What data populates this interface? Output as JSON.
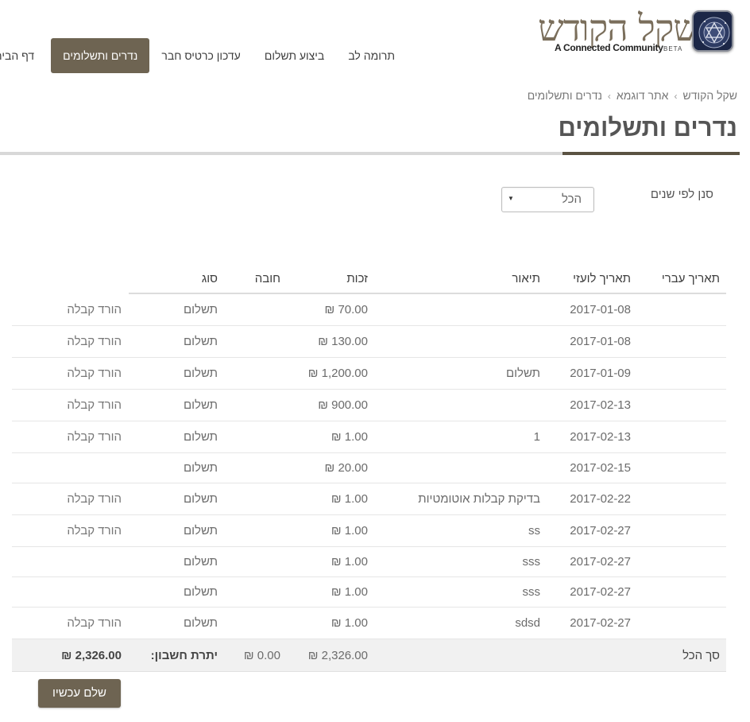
{
  "brand": {
    "name_hebrew": "שקל הקודש",
    "tagline": "A Connected Community",
    "beta": "BETA",
    "badge_color": "#1e2a4a",
    "logo_text_color": "#7a6e5b"
  },
  "nav": {
    "items": [
      {
        "label": "דף הבית",
        "active": false
      },
      {
        "label": "נדרים ותשלומים",
        "active": true
      },
      {
        "label": "עדכון כרטיס חבר",
        "active": false
      },
      {
        "label": "ביצוע תשלום",
        "active": false
      },
      {
        "label": "תרומה לב",
        "active": false
      }
    ],
    "active_color": "#6e6452"
  },
  "breadcrumb": {
    "items": [
      "שקל הקודש",
      "אתר דוגמא",
      "נדרים ותשלומים"
    ]
  },
  "page": {
    "title": "נדרים ותשלומים"
  },
  "filter": {
    "label": "סנן לפי שנים",
    "selected": "הכל"
  },
  "table": {
    "headers": {
      "hebrew_date": "תאריך עברי",
      "gregorian_date": "תאריך לועזי",
      "description": "תיאור",
      "credit": "זכות",
      "debit": "חובה",
      "type": "סוג",
      "action": ""
    },
    "rows": [
      {
        "hebrew_date": "",
        "date": "2017-01-08",
        "description": "",
        "credit": "₪ 70.00",
        "debit": "",
        "type": "תשלום",
        "action": "הורד קבלה"
      },
      {
        "hebrew_date": "",
        "date": "2017-01-08",
        "description": "",
        "credit": "₪ 130.00",
        "debit": "",
        "type": "תשלום",
        "action": "הורד קבלה"
      },
      {
        "hebrew_date": "",
        "date": "2017-01-09",
        "description": "תשלום",
        "credit": "₪ 1,200.00",
        "debit": "",
        "type": "תשלום",
        "action": "הורד קבלה"
      },
      {
        "hebrew_date": "",
        "date": "2017-02-13",
        "description": "",
        "credit": "₪ 900.00",
        "debit": "",
        "type": "תשלום",
        "action": "הורד קבלה"
      },
      {
        "hebrew_date": "",
        "date": "2017-02-13",
        "description": "1",
        "credit": "₪ 1.00",
        "debit": "",
        "type": "תשלום",
        "action": "הורד קבלה"
      },
      {
        "hebrew_date": "",
        "date": "2017-02-15",
        "description": "",
        "credit": "₪ 20.00",
        "debit": "",
        "type": "תשלום",
        "action": ""
      },
      {
        "hebrew_date": "",
        "date": "2017-02-22",
        "description": "בדיקת קבלות אוטומטיות",
        "credit": "₪ 1.00",
        "debit": "",
        "type": "תשלום",
        "action": "הורד קבלה"
      },
      {
        "hebrew_date": "",
        "date": "2017-02-27",
        "description": "ss",
        "credit": "₪ 1.00",
        "debit": "",
        "type": "תשלום",
        "action": "הורד קבלה"
      },
      {
        "hebrew_date": "",
        "date": "2017-02-27",
        "description": "sss",
        "credit": "₪ 1.00",
        "debit": "",
        "type": "תשלום",
        "action": ""
      },
      {
        "hebrew_date": "",
        "date": "2017-02-27",
        "description": "sss",
        "credit": "₪ 1.00",
        "debit": "",
        "type": "תשלום",
        "action": ""
      },
      {
        "hebrew_date": "",
        "date": "2017-02-27",
        "description": "sdsd",
        "credit": "₪ 1.00",
        "debit": "",
        "type": "תשלום",
        "action": "הורד קבלה"
      }
    ],
    "total": {
      "label": "סך הכל",
      "credit": "₪ 2,326.00",
      "debit": "₪ 0.00",
      "balance_label": "יתרת חשבון:",
      "balance": "₪ 2,326.00"
    }
  },
  "pay_button": {
    "label": "שלם עכשיו"
  }
}
